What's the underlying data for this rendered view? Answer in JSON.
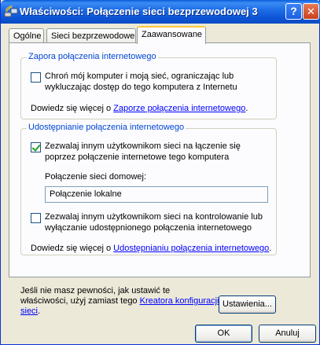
{
  "window": {
    "title": "Właściwości: Połączenie sieci bezprzewodowej 3"
  },
  "titlebar_buttons": {
    "help": "?",
    "close": "✕"
  },
  "tabs": [
    {
      "label": "Ogólne",
      "active": false
    },
    {
      "label": "Sieci bezprzewodowe",
      "active": false
    },
    {
      "label": "Zaawansowane",
      "active": true
    }
  ],
  "firewall": {
    "title": "Zapora połączenia internetowego",
    "checkbox_line1": "Chroń mój komputer i moją sieć, ograniczając lub",
    "checkbox_line2": "wykluczając dostęp do tego komputera z Internetu",
    "checked": false,
    "learn_prefix": "Dowiedz się więcej o ",
    "learn_link": "Zaporze połączenia internetowego",
    "learn_suffix": "."
  },
  "sharing": {
    "title": "Udostępnianie połączenia internetowego",
    "allow_line1": "Zezwalaj innym użytkownikom sieci na łączenie się",
    "allow_line2": "poprzez połączenie internetowe tego komputera",
    "allow_checked": true,
    "home_label": "Połączenie sieci domowej:",
    "home_value": "Połączenie lokalne",
    "control_line1": "Zezwalaj innym użytkownikom sieci na kontrolowanie lub",
    "control_line2": "wyłączanie udostępnionego połączenia internetowego",
    "control_checked": false,
    "learn_prefix": "Dowiedz się więcej o ",
    "learn_link": "Udostępnianiu połączenia internetowego",
    "learn_suffix": "."
  },
  "help": {
    "line1": "Jeśli nie masz pewności, jak ustawić te",
    "line2_prefix": "właściwości, użyj zamiast tego ",
    "line2_link": "Kreatora konfiguracji",
    "line3_link": "sieci",
    "line3_suffix": ".",
    "settings_button": "Ustawienia..."
  },
  "footer": {
    "ok": "OK",
    "cancel": "Anuluj"
  }
}
